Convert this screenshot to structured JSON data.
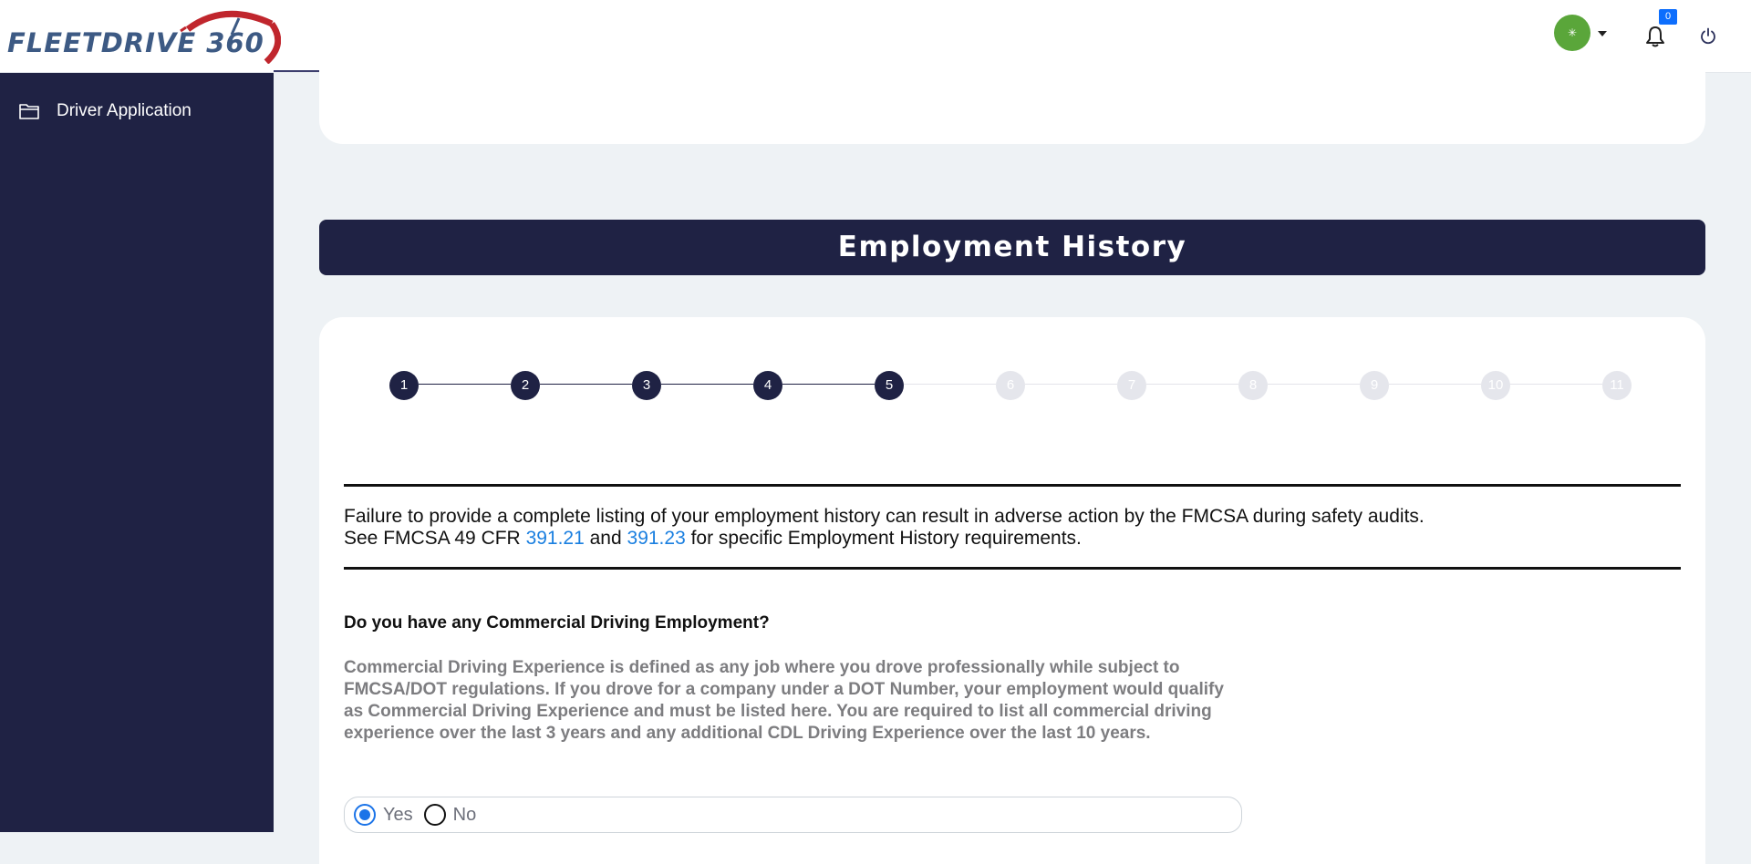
{
  "header": {
    "logo_text": "FLEETDRIVE 360",
    "avatar_glyph": "✳",
    "notification_count": "0"
  },
  "sidebar": {
    "items": [
      {
        "label": "Driver Application",
        "icon": "folder-icon"
      }
    ]
  },
  "section": {
    "title": "Employment History"
  },
  "stepper": {
    "steps": [
      "1",
      "2",
      "3",
      "4",
      "5",
      "6",
      "7",
      "8",
      "9",
      "10",
      "11"
    ],
    "current_step": 5,
    "completed_color": "#1f2244",
    "pending_color": "#e5e6ec"
  },
  "notice": {
    "line1": "Failure to provide a complete listing of your employment history can result in adverse action by the FMCSA during safety audits.",
    "line2_prefix": "See FMCSA 49 CFR ",
    "link1": "391.21",
    "line2_mid": " and ",
    "link2": "391.23",
    "line2_suffix": " for specific Employment History requirements."
  },
  "question": {
    "label": "Do you have any Commercial Driving Employment?",
    "description": "Commercial Driving Experience is defined as any job where you drove professionally while subject to FMCSA/DOT regulations. If you drove for a company under a DOT Number, your employment would qualify as Commercial Driving Experience and must be listed here. You are required to list all commercial driving experience over the last 3 years and any additional CDL Driving Experience over the last 10 years.",
    "options": [
      "Yes",
      "No"
    ],
    "selected": "Yes"
  },
  "colors": {
    "navy": "#1f2244",
    "link": "#1a7fe0",
    "avatar": "#5aa63a",
    "badge": "#0d6efd"
  }
}
